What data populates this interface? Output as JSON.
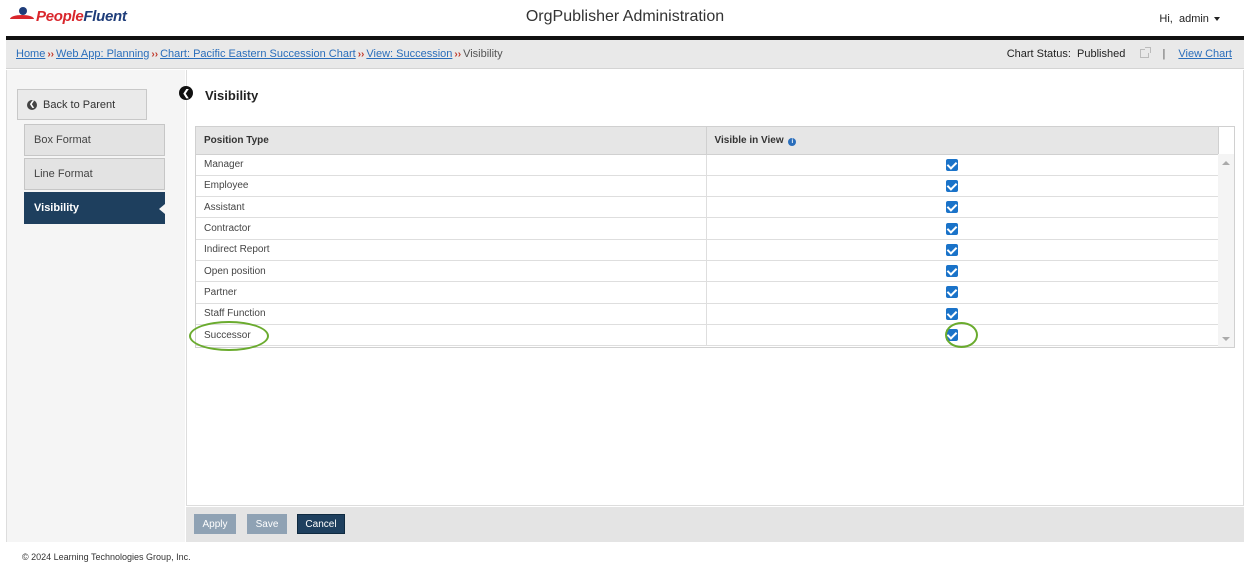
{
  "header": {
    "logo_part1": "People",
    "logo_part2": "Fluent",
    "app_title": "OrgPublisher Administration",
    "greeting": "Hi,",
    "username": "admin"
  },
  "breadcrumb": {
    "items": [
      "Home",
      "Web App: Planning",
      "Chart: Pacific Eastern Succession Chart",
      "View: Succession"
    ],
    "current": "Visibility",
    "separator": "››"
  },
  "status": {
    "label": "Chart Status:",
    "value": "Published",
    "pipe": "|",
    "view_chart": "View Chart"
  },
  "sidebar": {
    "back_label": "Back to Parent",
    "items": [
      {
        "label": "Box Format",
        "active": false
      },
      {
        "label": "Line Format",
        "active": false
      },
      {
        "label": "Visibility",
        "active": true
      }
    ]
  },
  "main": {
    "title": "Visibility",
    "columns": [
      "Position Type",
      "Visible in View"
    ],
    "rows": [
      {
        "type": "Manager",
        "visible": true
      },
      {
        "type": "Employee",
        "visible": true
      },
      {
        "type": "Assistant",
        "visible": true
      },
      {
        "type": "Contractor",
        "visible": true
      },
      {
        "type": "Indirect Report",
        "visible": true
      },
      {
        "type": "Open position",
        "visible": true
      },
      {
        "type": "Partner",
        "visible": true
      },
      {
        "type": "Staff Function",
        "visible": true
      },
      {
        "type": "Successor",
        "visible": true
      }
    ]
  },
  "actions": {
    "apply": "Apply",
    "save": "Save",
    "cancel": "Cancel"
  },
  "footer": {
    "copyright": "© 2024 Learning Technologies Group, Inc."
  },
  "colors": {
    "accent_dark": "#1e3f5e",
    "link": "#2a6ebb",
    "checkbox": "#1a73c9",
    "highlight": "#6aab2e",
    "brand_red": "#d9262c",
    "brand_blue": "#1f3d7a"
  },
  "icons": [
    "logo-mark",
    "user-caret-icon",
    "external-link-icon",
    "back-arrow-icon",
    "collapse-left-icon",
    "info-icon",
    "checkbox-checked-icon",
    "scroll-up-icon",
    "scroll-down-icon"
  ]
}
